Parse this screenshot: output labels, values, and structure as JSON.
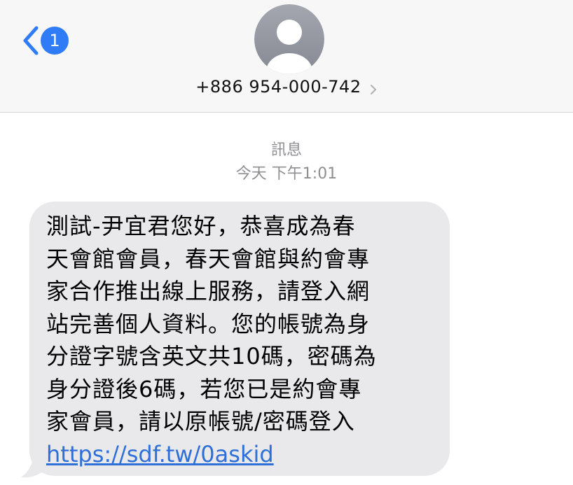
{
  "header": {
    "back_badge": "1",
    "contact_name": "+886 954-000-742"
  },
  "conversation": {
    "service_label": "訊息",
    "timestamp": "今天 下午1:01"
  },
  "message": {
    "lines": [
      "測試-尹宜君您好，恭喜成為春",
      "天會館會員，春天會館與約會專",
      "家合作推出線上服務，請登入網",
      "站完善個人資料。您的帳號為身",
      "分證字號含英文共10碼，密碼為",
      "身分證後6碼，若您已是約會專",
      "家會員，請以原帳號/密碼登入"
    ],
    "link": "https://sdf.tw/0askid"
  },
  "colors": {
    "accent": "#2f7cf6",
    "bubble": "#e9e9eb",
    "meta_text": "#8e8e93"
  },
  "icons": {
    "back": "chevron-left-icon",
    "avatar": "person-avatar-icon",
    "contact_chevron": "chevron-right-icon"
  }
}
